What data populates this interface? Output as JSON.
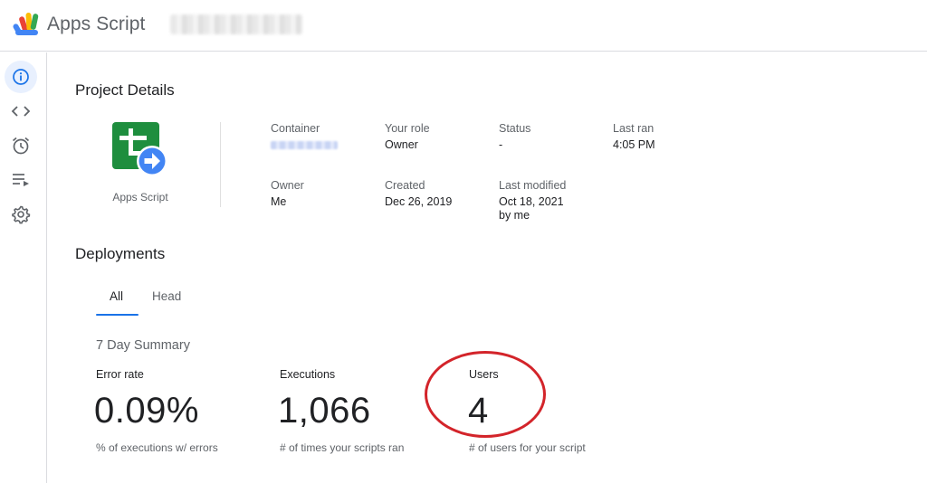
{
  "header": {
    "app_title": "Apps Script",
    "logo_icon": "apps-script-logo-icon"
  },
  "sidebar": {
    "items": [
      {
        "icon": "info-icon",
        "active": true
      },
      {
        "icon": "code-brackets-icon",
        "active": false
      },
      {
        "icon": "alarm-clock-icon",
        "active": false
      },
      {
        "icon": "executions-list-icon",
        "active": false
      },
      {
        "icon": "gear-icon",
        "active": false
      }
    ]
  },
  "project_details": {
    "heading": "Project Details",
    "icon": "sheets-apps-script-icon",
    "icon_label": "Apps Script",
    "fields": {
      "container_label": "Container",
      "your_role_label": "Your role",
      "your_role_value": "Owner",
      "status_label": "Status",
      "status_value": "-",
      "last_ran_label": "Last ran",
      "last_ran_value": "4:05 PM",
      "owner_label": "Owner",
      "owner_value": "Me",
      "created_label": "Created",
      "created_value": "Dec 26, 2019",
      "last_modified_label": "Last modified",
      "last_modified_date": "Oct 18, 2021",
      "last_modified_by": "by me"
    }
  },
  "deployments": {
    "heading": "Deployments",
    "tabs": [
      {
        "label": "All",
        "active": true
      },
      {
        "label": "Head",
        "active": false
      }
    ],
    "summary_title": "7 Day Summary",
    "stats": [
      {
        "label": "Error rate",
        "value": "0.09%",
        "caption": "% of executions w/ errors"
      },
      {
        "label": "Executions",
        "value": "1,066",
        "caption": "# of times your scripts ran"
      },
      {
        "label": "Users",
        "value": "4",
        "caption": "# of users for your script"
      }
    ]
  },
  "colors": {
    "accent": "#1a73e8",
    "annotation": "#d3242a",
    "sheets_green": "#1e8e3e",
    "divider": "#dadce0"
  }
}
